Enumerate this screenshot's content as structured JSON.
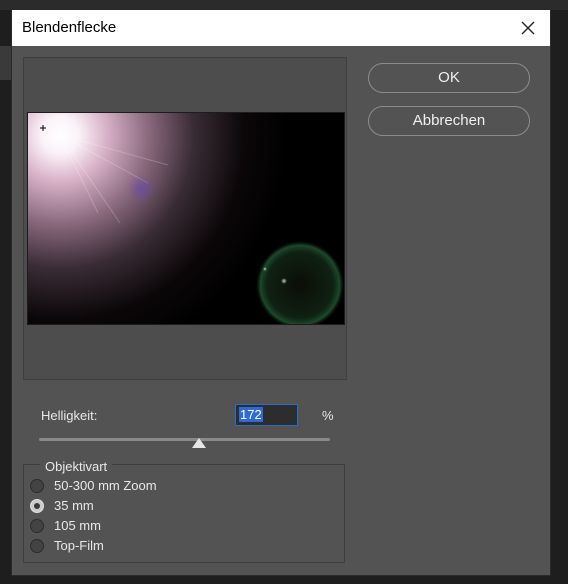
{
  "dialog": {
    "title": "Blendenflecke",
    "close_icon": "close-icon"
  },
  "buttons": {
    "ok": "OK",
    "cancel": "Abbrechen"
  },
  "brightness": {
    "label": "Helligkeit:",
    "value": "172",
    "unit": "%",
    "slider_fraction": 0.55
  },
  "lens_type": {
    "legend": "Objektivart",
    "options": [
      {
        "label": "50-300 mm Zoom",
        "checked": false
      },
      {
        "label": "35 mm",
        "checked": true
      },
      {
        "label": "105 mm",
        "checked": false
      },
      {
        "label": "Top-Film",
        "checked": false
      }
    ]
  },
  "colors": {
    "dialog_bg": "#535353",
    "accent": "#2a6ec8"
  },
  "icons": {
    "flare_center": "crosshair-icon"
  }
}
